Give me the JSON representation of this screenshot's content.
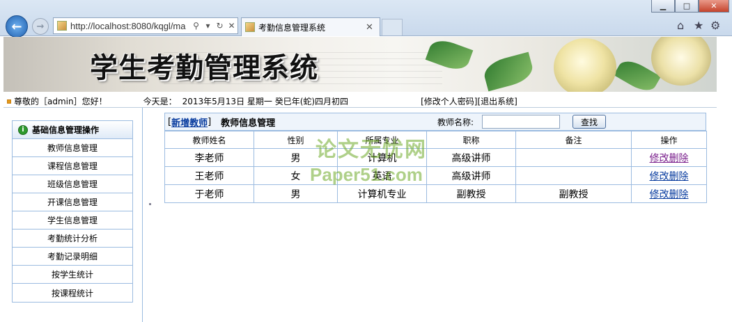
{
  "browser": {
    "url": "http://localhost:8080/kqgl/ma",
    "tab_title": "考勤信息管理系统"
  },
  "banner": {
    "title": "学生考勤管理系统"
  },
  "infobar": {
    "greeting": "尊敬的［admin］您好！",
    "date_label": "今天是：",
    "date": "2013年5月13日 星期一 癸巳年(蛇)四月初四",
    "change_password": "[修改个人密码]",
    "logout": "[退出系统]"
  },
  "sidebar": {
    "header": "基础信息管理操作",
    "items": [
      "教师信息管理",
      "课程信息管理",
      "班级信息管理",
      "开课信息管理",
      "学生信息管理",
      "考勤统计分析",
      "考勤记录明细",
      "按学生统计",
      "按课程统计"
    ]
  },
  "main": {
    "add_link": "新增教师",
    "add_bracket_open": "[",
    "add_bracket_close": "]",
    "page_title": "教师信息管理",
    "search_label": "教师名称:",
    "search_value": "",
    "search_button": "查找",
    "columns": [
      "教师姓名",
      "性别",
      "所属专业",
      "职称",
      "备注",
      "操作"
    ],
    "rows": [
      {
        "name": "李老师",
        "gender": "男",
        "major": "计算机",
        "title": "高级讲师",
        "note": "",
        "edit": "修改",
        "delete": "删除"
      },
      {
        "name": "王老师",
        "gender": "女",
        "major": "英语",
        "title": "高级讲师",
        "note": "",
        "edit": "修改",
        "delete": "删除"
      },
      {
        "name": "于老师",
        "gender": "男",
        "major": "计算机专业",
        "title": "副教授",
        "note": "副教授",
        "edit": "修改",
        "delete": "删除"
      }
    ]
  },
  "watermark": {
    "line1": "论文无忧网",
    "line2": "Paper51.com"
  }
}
